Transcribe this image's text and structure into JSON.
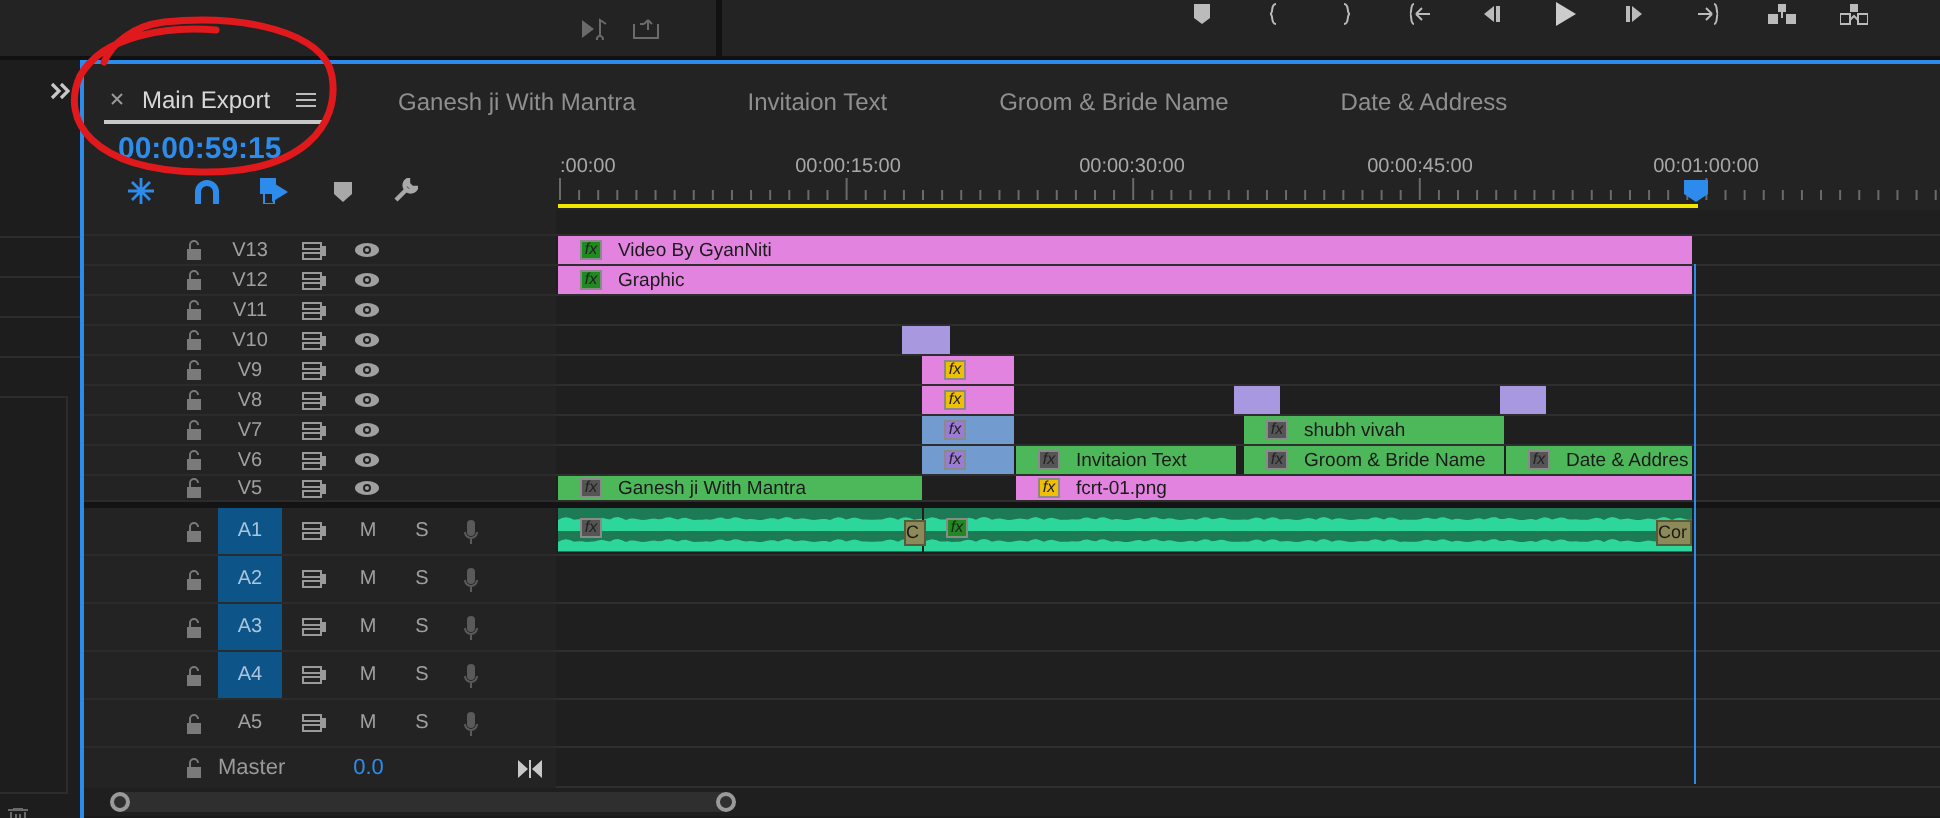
{
  "tabs": [
    {
      "label": "Main Export",
      "selected": true
    },
    {
      "label": "Ganesh ji With Mantra",
      "selected": false
    },
    {
      "label": "Invitaion Text",
      "selected": false
    },
    {
      "label": "Groom & Bride Name",
      "selected": false
    },
    {
      "label": "Date & Address",
      "selected": false
    }
  ],
  "timecode": "00:00:59:15",
  "ruler": {
    "labels": [
      ":00:00",
      "00:00:15:00",
      "00:00:30:00",
      "00:00:45:00",
      "00:01:00:00"
    ]
  },
  "video_tracks": [
    {
      "name": "V13",
      "clips": [
        {
          "label": "Video By GyanNiti",
          "color": "#e283e0",
          "fx": {
            "text": "fx",
            "color": "#1f8a1f"
          }
        }
      ]
    },
    {
      "name": "V12",
      "clips": [
        {
          "label": "Graphic",
          "color": "#e283e0",
          "fx": {
            "text": "fx",
            "color": "#1f8a1f"
          }
        }
      ]
    },
    {
      "name": "V11"
    },
    {
      "name": "V10",
      "clips": [
        {
          "color": "#a898e0"
        }
      ]
    },
    {
      "name": "V9",
      "clips": [
        {
          "color": "#e283e0",
          "fx": {
            "text": "fx",
            "color": "#f0c000"
          }
        }
      ]
    },
    {
      "name": "V8",
      "clips": [
        {
          "color": "#e283e0",
          "fx": {
            "text": "fx",
            "color": "#f0c000"
          }
        },
        {
          "color": "#a898e0"
        },
        {
          "color": "#a898e0"
        }
      ]
    },
    {
      "name": "V7",
      "clips": [
        {
          "color": "#729ccf",
          "fx": {
            "text": "fx",
            "color": "#9b7ad8"
          }
        },
        {
          "label": "shubh vivah",
          "color": "#4db85a",
          "fx": {
            "text": "fx",
            "color": "#555555"
          }
        }
      ]
    },
    {
      "name": "V6",
      "clips": [
        {
          "color": "#729ccf",
          "fx": {
            "text": "fx",
            "color": "#9b7ad8"
          }
        },
        {
          "label": "Invitaion Text",
          "color": "#4db85a",
          "fx": {
            "text": "fx",
            "color": "#555555"
          }
        },
        {
          "label": "Groom & Bride Name",
          "color": "#4db85a",
          "fx": {
            "text": "fx",
            "color": "#555555"
          }
        },
        {
          "label": "Date & Addres",
          "color": "#4db85a",
          "fx": {
            "text": "fx",
            "color": "#555555"
          }
        }
      ]
    },
    {
      "name": "V5",
      "clips": [
        {
          "label": "Ganesh ji With Mantra",
          "color": "#4db85a",
          "fx": {
            "text": "fx",
            "color": "#555555"
          }
        },
        {
          "label": "fcrt-01.png",
          "color": "#e283e0",
          "fx": {
            "text": "fx",
            "color": "#f0c000"
          }
        }
      ]
    }
  ],
  "audio_tracks": [
    {
      "name": "A1",
      "selected": true,
      "buttons": [
        "M",
        "S"
      ],
      "clips": [
        {
          "color": "#1c7a55",
          "fx": {
            "text": "fx",
            "color": "#555555"
          }
        },
        {
          "color": "#1c7a55",
          "fx": {
            "text": "fx",
            "color": "#1f8a1f"
          }
        }
      ],
      "transitions": [
        {
          "label": "C"
        },
        {
          "label": "Cor"
        }
      ]
    },
    {
      "name": "A2",
      "selected": true,
      "buttons": [
        "M",
        "S"
      ]
    },
    {
      "name": "A3",
      "selected": true,
      "buttons": [
        "M",
        "S"
      ]
    },
    {
      "name": "A4",
      "selected": true,
      "buttons": [
        "M",
        "S"
      ]
    },
    {
      "name": "A5",
      "selected": false,
      "buttons": [
        "M",
        "S"
      ]
    }
  ],
  "master": {
    "label": "Master",
    "value": "0.0"
  }
}
